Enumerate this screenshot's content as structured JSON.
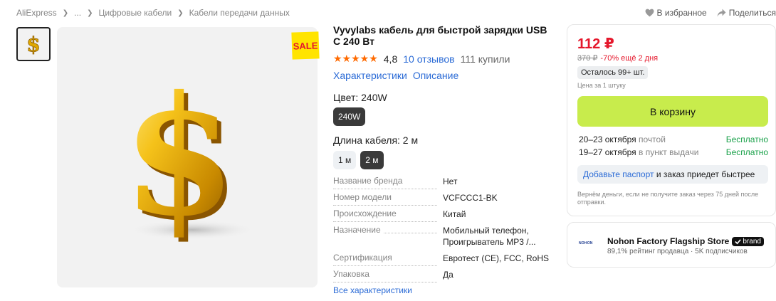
{
  "breadcrumb": [
    "AliExpress",
    "...",
    "Цифровые кабели",
    "Кабели передачи данных"
  ],
  "actions": {
    "favorite": "В избранное",
    "share": "Поделиться"
  },
  "badge": "SALE",
  "product": {
    "title": "Vyvylabs кабель для быстрой зарядки USB C 240 Вт",
    "rating": "4,8",
    "reviews": "10 отзывов",
    "bought": "111 купили",
    "tabs": [
      "Характеристики",
      "Описание"
    ],
    "color_label": "Цвет: 240W",
    "color_options": [
      "240W"
    ],
    "length_label": "Длина кабеля: 2 м",
    "length_options": [
      "1 м",
      "2 м"
    ]
  },
  "specs": [
    {
      "key": "Название бренда",
      "value": "Нет"
    },
    {
      "key": "Номер модели",
      "value": "VCFCCC1-BK"
    },
    {
      "key": "Происхождение",
      "value": "Китай"
    },
    {
      "key": "Назначение",
      "value": "Мобильный телефон,",
      "value2": "Проигрыватель MP3 /..."
    },
    {
      "key": "Сертификация",
      "value": "Евротест (CE), FCC, RoHS"
    },
    {
      "key": "Упаковка",
      "value": "Да"
    }
  ],
  "all_specs_link": "Все характеристики",
  "buy": {
    "price": "112 ₽",
    "old_price": "370 ₽",
    "discount": "-70% ещё 2 дня",
    "stock": "Осталось 99+ шт.",
    "unit": "Цена за 1 штуку",
    "cart_button": "В корзину",
    "delivery": [
      {
        "date": "20–23 октября",
        "via": "почтой",
        "cost": "Бесплатно"
      },
      {
        "date": "19–27 октября",
        "via": "в пункт выдачи",
        "cost": "Бесплатно"
      }
    ],
    "passport_link": "Добавьте паспорт",
    "passport_text": " и заказ приедет быстрее",
    "refund": "Вернём деньги, если не получите заказ через 75 дней после отправки."
  },
  "store": {
    "logo": "NOHON",
    "name": "Nohon Factory Flagship Store",
    "badge": "brand",
    "rating": "89,1% рейтинг продавца",
    "subs": "5K подписчиков"
  },
  "colors": {
    "price": "#e5172b",
    "cart": "#c8ec4c",
    "link": "#2b6bd6",
    "free": "#1aa14a",
    "stars": "#ff6a00"
  }
}
